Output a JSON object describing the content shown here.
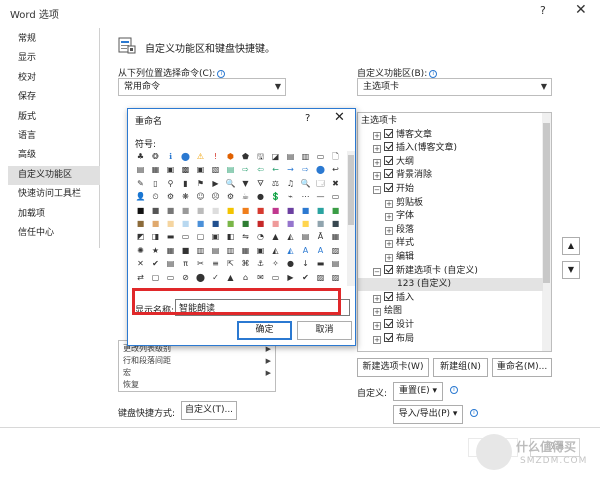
{
  "window": {
    "title": "Word 选项",
    "help": "?",
    "close": "✕"
  },
  "nav": {
    "items": [
      "常规",
      "显示",
      "校对",
      "保存",
      "版式",
      "语言",
      "高级",
      "自定义功能区",
      "快速访问工具栏",
      "加载项",
      "信任中心"
    ],
    "selected_index": 7
  },
  "header": {
    "title": "自定义功能区和键盘快捷键。"
  },
  "left_panel": {
    "choose_label": "从下列位置选择命令(C):",
    "choose_value": "常用命令",
    "commands": [
      "更改列表级别",
      "行和段落间距",
      "宏",
      "恢复"
    ],
    "keyboard_label": "键盘快捷方式:",
    "keyboard_button": "自定义(T)..."
  },
  "right_panel": {
    "customize_label": "自定义功能区(B):",
    "customize_value": "主选项卡",
    "tree": [
      {
        "indent": 0,
        "exp": "",
        "check": "",
        "text": "主选项卡"
      },
      {
        "indent": 1,
        "exp": "+",
        "check": "on",
        "text": "博客文章"
      },
      {
        "indent": 1,
        "exp": "+",
        "check": "on",
        "text": "插入(博客文章)"
      },
      {
        "indent": 1,
        "exp": "+",
        "check": "on",
        "text": "大纲"
      },
      {
        "indent": 1,
        "exp": "+",
        "check": "on",
        "text": "背景消除"
      },
      {
        "indent": 1,
        "exp": "−",
        "check": "on",
        "text": "开始"
      },
      {
        "indent": 2,
        "exp": "+",
        "check": "",
        "text": "剪贴板"
      },
      {
        "indent": 2,
        "exp": "+",
        "check": "",
        "text": "字体"
      },
      {
        "indent": 2,
        "exp": "+",
        "check": "",
        "text": "段落"
      },
      {
        "indent": 2,
        "exp": "+",
        "check": "",
        "text": "样式"
      },
      {
        "indent": 2,
        "exp": "+",
        "check": "",
        "text": "编辑"
      },
      {
        "indent": 1,
        "exp": "−",
        "check": "on",
        "text": "新建选项卡 (自定义)"
      },
      {
        "indent": 3,
        "exp": "",
        "check": "",
        "text": "123 (自定义)",
        "selected": true
      },
      {
        "indent": 1,
        "exp": "+",
        "check": "on",
        "text": "插入"
      },
      {
        "indent": 1,
        "exp": "+",
        "check": "",
        "text": "绘图"
      },
      {
        "indent": 1,
        "exp": "+",
        "check": "on",
        "text": "设计"
      },
      {
        "indent": 1,
        "exp": "+",
        "check": "on",
        "text": "布局"
      }
    ],
    "new_tab_button": "新建选项卡(W)",
    "new_group_button": "新建组(N)",
    "rename_button": "重命名(M)...",
    "customize_text": "自定义:",
    "reset_button": "重置(E) ▾",
    "import_export_button": "导入/导出(P) ▾",
    "up_arrow": "▲",
    "down_arrow": "▼"
  },
  "dialog": {
    "title": "重命名",
    "help": "?",
    "close": "✕",
    "symbol_label": "符号:",
    "symbols": [
      "♣",
      "❂",
      "ℹ",
      "⬤",
      "⚠",
      "!",
      "⬢",
      "⬟",
      "🖫",
      "◪",
      "▤",
      "▥",
      "▭",
      "🗋",
      "▤",
      "▦",
      "▣",
      "▩",
      "▣",
      "▧",
      "▤",
      "⇨",
      "⇦",
      "←",
      "→",
      "⇨",
      "⬤",
      "↩",
      "✎",
      "▯",
      "⚲",
      "▮",
      "⚑",
      "▶",
      "🔍",
      "▼",
      "🜃",
      "⚖",
      "♫",
      "🔍",
      "🗔",
      "✖",
      "👤",
      "⏲",
      "⚙",
      "❋",
      "☺",
      "☹",
      "⚙",
      "☕",
      "●",
      "💲",
      "⌁",
      "⋯",
      "—",
      "▭",
      "■",
      "■",
      "■",
      "■",
      "■",
      "■",
      "■",
      "■",
      "■",
      "■",
      "■",
      "■",
      "■",
      "■",
      "■",
      "■",
      "■",
      "■",
      "■",
      "■",
      "■",
      "■",
      "■",
      "■",
      "■",
      "■",
      "■",
      "■",
      "◩",
      "◨",
      "▬",
      "▭",
      "▢",
      "▣",
      "◧",
      "⇋",
      "◔",
      "▲",
      "◭",
      "▤",
      "Ā",
      "▦",
      "✺",
      "★",
      "▦",
      "■",
      "▥",
      "▤",
      "▥",
      "▦",
      "▣",
      "◭",
      "◭",
      "A",
      "A",
      "▨",
      "✕",
      "✔",
      "▤",
      "π",
      "✂",
      "≡",
      "⇱",
      "⌘",
      "⚓",
      "✧",
      "●",
      "↓",
      "▬",
      "▤",
      "⇄",
      "▢",
      "▭",
      "⊘",
      "⬤",
      "✓",
      "▲",
      "⌂",
      "✉",
      "▭",
      "▶",
      "✔",
      "▨",
      "▨"
    ],
    "name_label": "显示名称:",
    "name_value": "智能朗读",
    "ok_button": "确定",
    "cancel_button": "取消"
  },
  "footer": {
    "confirm_button": "确定",
    "cancel_button": "取消"
  },
  "watermark": {
    "title": "什么值得买",
    "subtitle": "SMZDM.COM"
  }
}
